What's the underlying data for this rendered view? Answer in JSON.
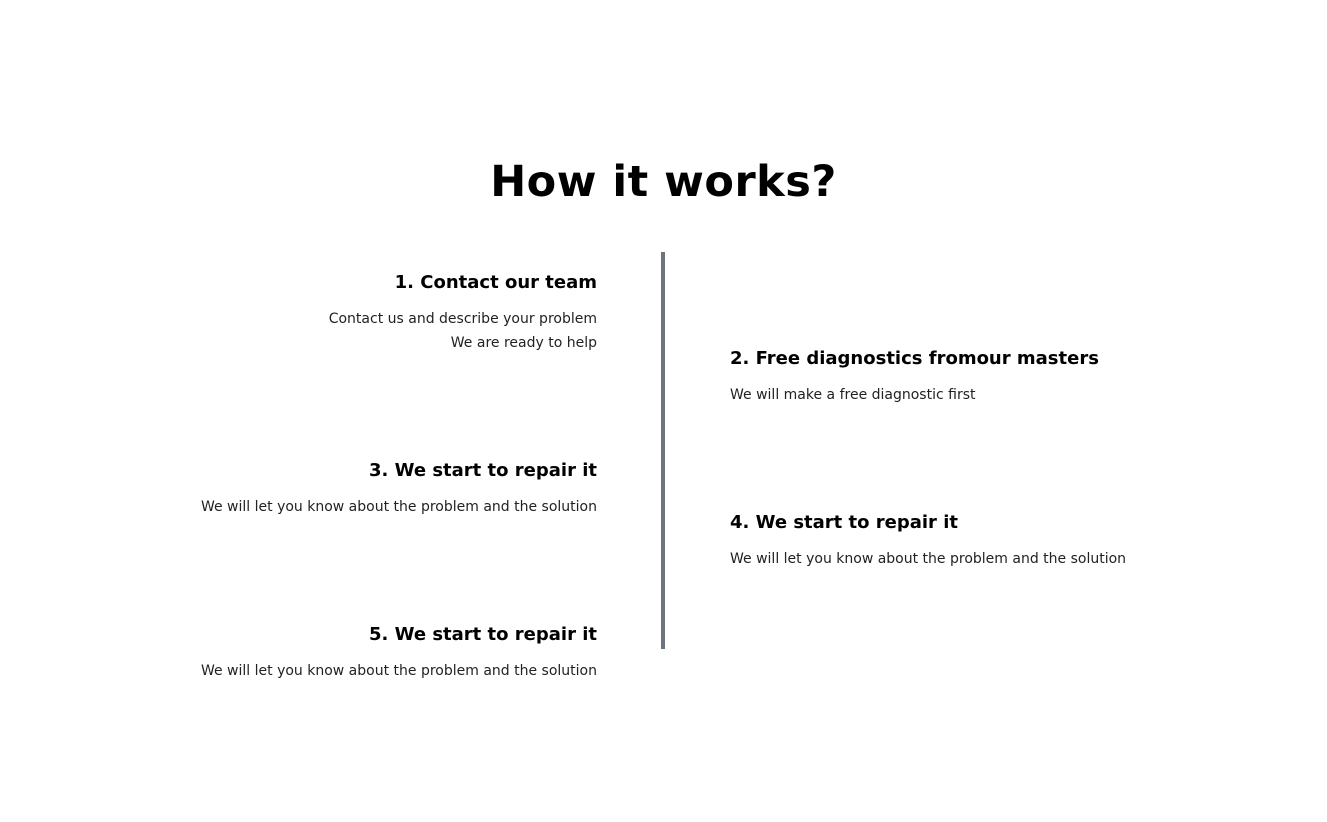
{
  "section": {
    "title": "How it works?"
  },
  "steps": [
    {
      "title": "1. Contact our team",
      "lines": [
        "Contact us and describe your problem",
        "We are ready to help"
      ]
    },
    {
      "title": "2. Free diagnostics fromour masters",
      "lines": [
        "We will make a free diagnostic first"
      ]
    },
    {
      "title": "3. We start to repair it",
      "lines": [
        "We will let you know about the problem and the solution"
      ]
    },
    {
      "title": "4. We start to repair it",
      "lines": [
        "We will let you know about the problem and the solution"
      ]
    },
    {
      "title": "5. We start to repair it",
      "lines": [
        "We will let you know about the problem and the solution"
      ]
    }
  ],
  "colors": {
    "background": "#ffffff",
    "text": "#000000",
    "timeline": "#6c757d"
  }
}
